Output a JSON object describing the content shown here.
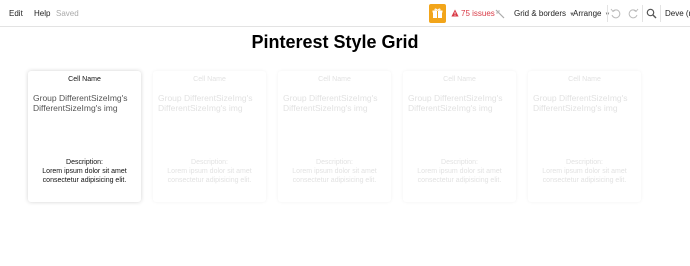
{
  "toolbar": {
    "edit": "Edit",
    "help": "Help",
    "saved": "Saved",
    "issues": "75 issues",
    "grid_borders": "Grid & borders",
    "arrange": "Arrange",
    "deve": "Deve (re",
    "icons": [
      "gift-icon",
      "warning-icon",
      "magic-wand-icon",
      "undo-icon",
      "redo-icon",
      "search-icon"
    ],
    "colors": {
      "gift": "#f2a51a",
      "issues": "#d93a46"
    }
  },
  "main": {
    "title": "Pinterest Style Grid",
    "cards": [
      {
        "cell_name": "Cell Name",
        "group": "Group DifferentSizeImg's DifferentSizeImg's img",
        "desc_label": "Description:",
        "desc_text": "Lorem ipsum dolor sit amet consectetur adipisicing elit."
      },
      {
        "cell_name": "Cell Name",
        "group": "Group DifferentSizeImg's DifferentSizeImg's img",
        "desc_label": "Description:",
        "desc_text": "Lorem ipsum dolor sit amet consectetur adipisicing elit."
      },
      {
        "cell_name": "Cell Name",
        "group": "Group DifferentSizeImg's DifferentSizeImg's img",
        "desc_label": "Description:",
        "desc_text": "Lorem ipsum dolor sit amet consectetur adipisicing elit."
      },
      {
        "cell_name": "Cell Name",
        "group": "Group DifferentSizeImg's DifferentSizeImg's img",
        "desc_label": "Description:",
        "desc_text": "Lorem ipsum dolor sit amet consectetur adipisicing elit."
      },
      {
        "cell_name": "Cell Name",
        "group": "Group DifferentSizeImg's DifferentSizeImg's img",
        "desc_label": "Description:",
        "desc_text": "Lorem ipsum dolor sit amet consectetur adipisicing elit."
      }
    ]
  }
}
